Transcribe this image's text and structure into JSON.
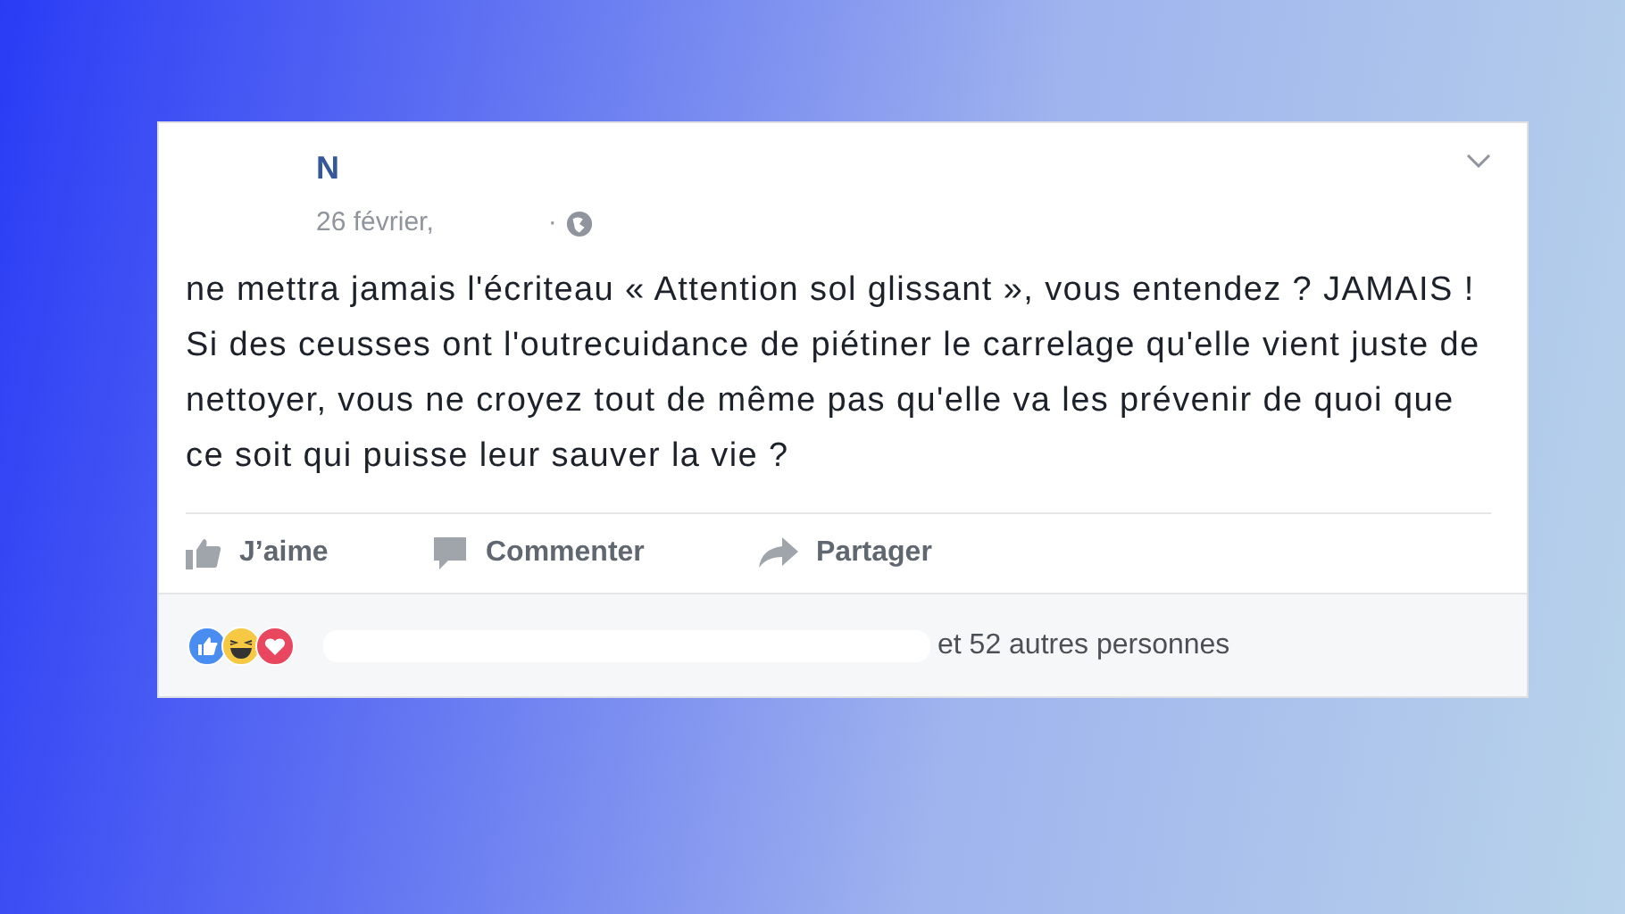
{
  "post": {
    "author": "N",
    "date": "26 février,",
    "separator": "·",
    "text": "ne mettra jamais l'écriteau « Attention sol glissant », vous entendez ? JAMAIS ! Si des ceusses ont l'outrecuidance de piétiner le carrelage qu'elle vient juste de nettoyer, vous ne croyez tout de même pas qu'elle va les prévenir de quoi que ce soit qui puisse leur sauver la vie ?"
  },
  "actions": [
    {
      "kind": "like",
      "label": "J’aime"
    },
    {
      "kind": "comment",
      "label": "Commenter"
    },
    {
      "kind": "share",
      "label": "Partager"
    }
  ],
  "reactions": {
    "icons": [
      {
        "kind": "like"
      },
      {
        "kind": "haha"
      },
      {
        "kind": "love"
      }
    ],
    "summary": "et 52 autres personnes"
  }
}
